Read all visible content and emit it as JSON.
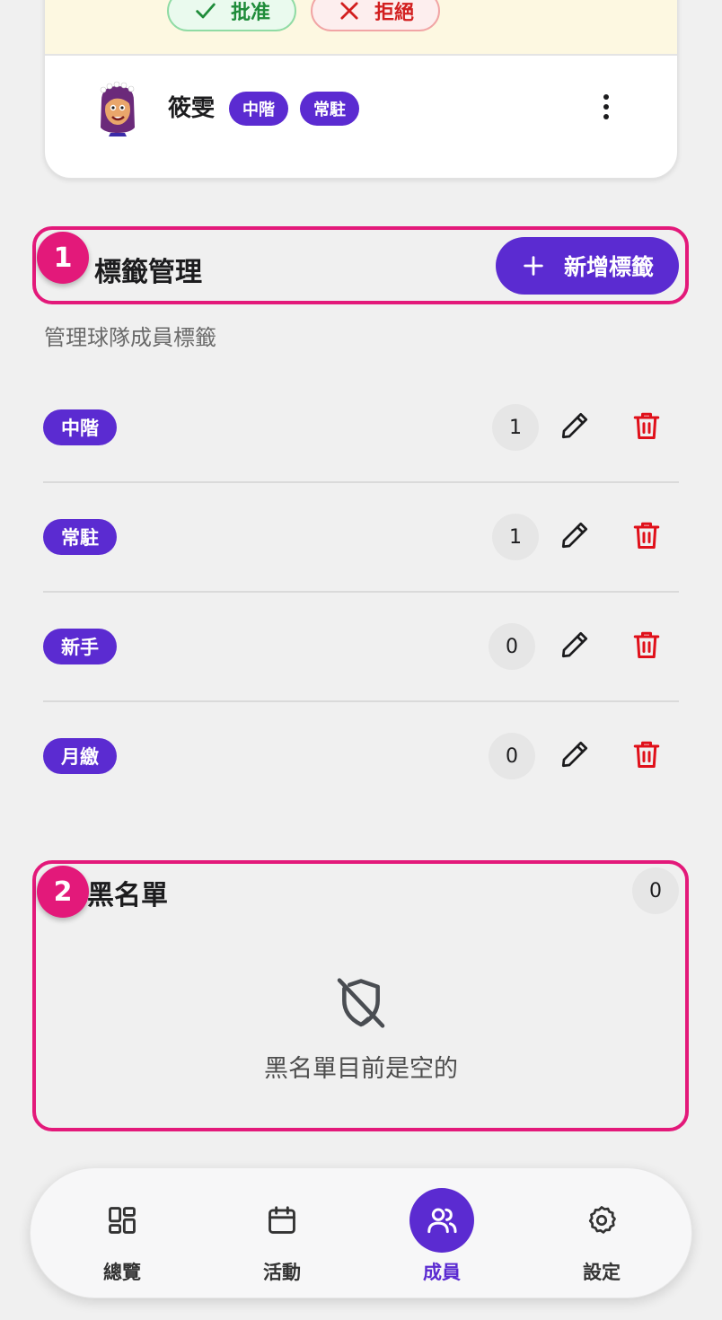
{
  "pending": {
    "approve_label": "批准",
    "reject_label": "拒絕",
    "member": {
      "name": "筱雯",
      "tags": [
        "中階",
        "常駐"
      ]
    }
  },
  "tag_management": {
    "step": "1",
    "title": "標籤管理",
    "add_button": "新增標籤",
    "subtitle": "管理球隊成員標籤",
    "tags": [
      {
        "label": "中階",
        "count": "1"
      },
      {
        "label": "常駐",
        "count": "1"
      },
      {
        "label": "新手",
        "count": "0"
      },
      {
        "label": "月繳",
        "count": "0"
      }
    ]
  },
  "blacklist": {
    "step": "2",
    "title": "黑名單",
    "count": "0",
    "empty_text": "黑名單目前是空的"
  },
  "nav": {
    "items": [
      {
        "label": "總覽",
        "icon": "dashboard-icon"
      },
      {
        "label": "活動",
        "icon": "calendar-icon"
      },
      {
        "label": "成員",
        "icon": "users-icon",
        "active": true
      },
      {
        "label": "設定",
        "icon": "gear-icon"
      }
    ]
  },
  "colors": {
    "accent": "#5b2bd1",
    "highlight": "#e3197a",
    "danger": "#e0101a",
    "approve": "#1f8c3a"
  }
}
